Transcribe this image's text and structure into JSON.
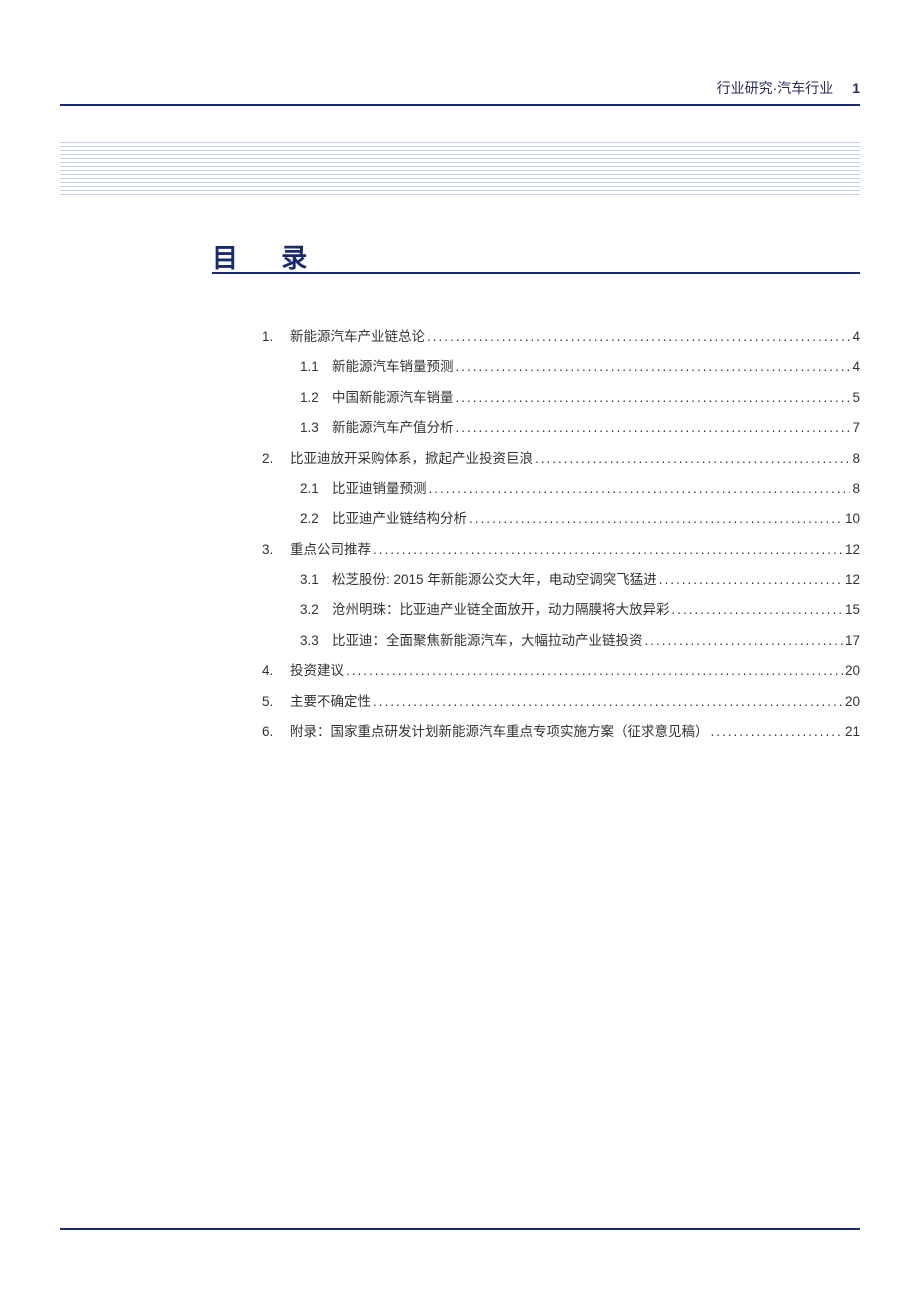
{
  "header": {
    "breadcrumb": "行业研究·汽车行业",
    "page_number": "1"
  },
  "toc": {
    "title": "目 录",
    "entries": [
      {
        "level": 1,
        "num": "1.",
        "text": "新能源汽车产业链总论",
        "page": "4"
      },
      {
        "level": 2,
        "num": "1.1",
        "text": "新能源汽车销量预测",
        "page": "4"
      },
      {
        "level": 2,
        "num": "1.2",
        "text": "中国新能源汽车销量",
        "page": "5"
      },
      {
        "level": 2,
        "num": "1.3",
        "text": "新能源汽车产值分析",
        "page": "7"
      },
      {
        "level": 1,
        "num": "2.",
        "text": "比亚迪放开采购体系，掀起产业投资巨浪",
        "page": "8"
      },
      {
        "level": 2,
        "num": "2.1",
        "text": "比亚迪销量预测",
        "page": "8"
      },
      {
        "level": 2,
        "num": "2.2",
        "text": "比亚迪产业链结构分析",
        "page": "10"
      },
      {
        "level": 1,
        "num": "3.",
        "text": "重点公司推荐",
        "page": "12"
      },
      {
        "level": 2,
        "num": "3.1",
        "text": "松芝股份: 2015 年新能源公交大年，电动空调突飞猛进",
        "page": "12"
      },
      {
        "level": 2,
        "num": "3.2",
        "text": "沧州明珠：比亚迪产业链全面放开，动力隔膜将大放异彩",
        "page": "15"
      },
      {
        "level": 2,
        "num": "3.3",
        "text": "比亚迪：全面聚焦新能源汽车，大幅拉动产业链投资",
        "page": "17"
      },
      {
        "level": 1,
        "num": "4.",
        "text": "投资建议",
        "page": "20"
      },
      {
        "level": 1,
        "num": "5.",
        "text": "主要不确定性",
        "page": "20"
      },
      {
        "level": 1,
        "num": "6.",
        "text": "附录：国家重点研发计划新能源汽车重点专项实施方案（征求意见稿）",
        "page": "21"
      }
    ]
  }
}
